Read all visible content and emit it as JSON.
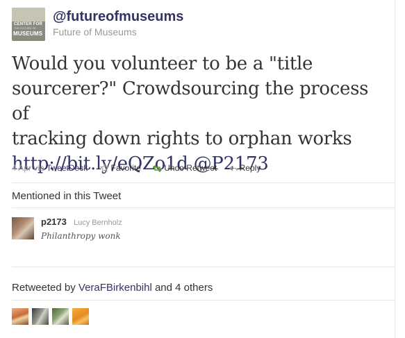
{
  "author": {
    "handle": "@futureofmuseums",
    "name": "Future of Museums",
    "logo_text": [
      "CENTER FOR",
      "THE FUTURE OF",
      "MUSEUMS"
    ]
  },
  "tweet": {
    "text_line1": "Would you volunteer to be a \"title",
    "text_line2": "sourcerer?\" Crowdsourcing the process of",
    "text_line3": "tracking down rights to orphan works",
    "link": "http://bit.ly/eQZo1d",
    "mention": "@P2173"
  },
  "meta": {
    "date": "4 Apr",
    "via": "via",
    "source": "TweetDeck",
    "favorite": "Favorite",
    "undo_retweet": "Undo Retweet",
    "reply": "Reply"
  },
  "mentioned": {
    "title": "Mentioned in this Tweet",
    "handle": "p2173",
    "name": "Lucy Bernholz",
    "bio": "Philanthropy wonk"
  },
  "retweeted": {
    "prefix": "Retweeted by",
    "user": "VeraFBirkenbihl",
    "suffix": "and 4 others"
  },
  "colors": {
    "accent": "#333366",
    "retweet_green": "#5c9a2e",
    "meta_gray": "#999999"
  }
}
